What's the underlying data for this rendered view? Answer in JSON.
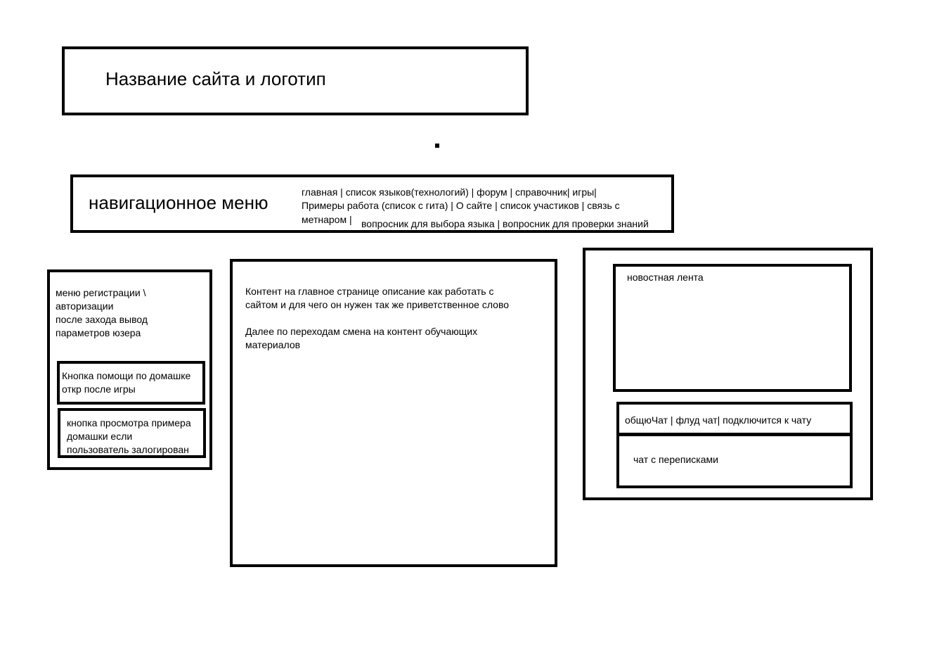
{
  "header": {
    "title": "Название сайта и логотип"
  },
  "nav": {
    "label": "навигационное меню",
    "line1": "главная | список языков(технологий) | форум | справочник| игры|",
    "line2": "Примеры работа (список с гита) | О сайте | список участиков | связь с",
    "line3a": "метнаром |",
    "line3b": "вопросник для выбора языка | вопросник для проверки знаний"
  },
  "left": {
    "text": "меню регистрации \\\nавторизации\nпосле захода вывод\nпараметров юзера",
    "help_button": "Кнопка помощи по домашке\nоткр после игры",
    "example_button": "кнопка просмотра примера\nдомашки если\nпользователь залогирован"
  },
  "center": {
    "text": "Контент на главное странице описание как работать с\nсайтом и для чего он нужен так же приветственное слово\n\nДалее по переходам смена на контент обучающих\nматериалов"
  },
  "right": {
    "news": "новостная лента",
    "chat_tabs": "общюЧат | флуд чат| подключится к чату",
    "chat_area": "чат с переписками"
  }
}
